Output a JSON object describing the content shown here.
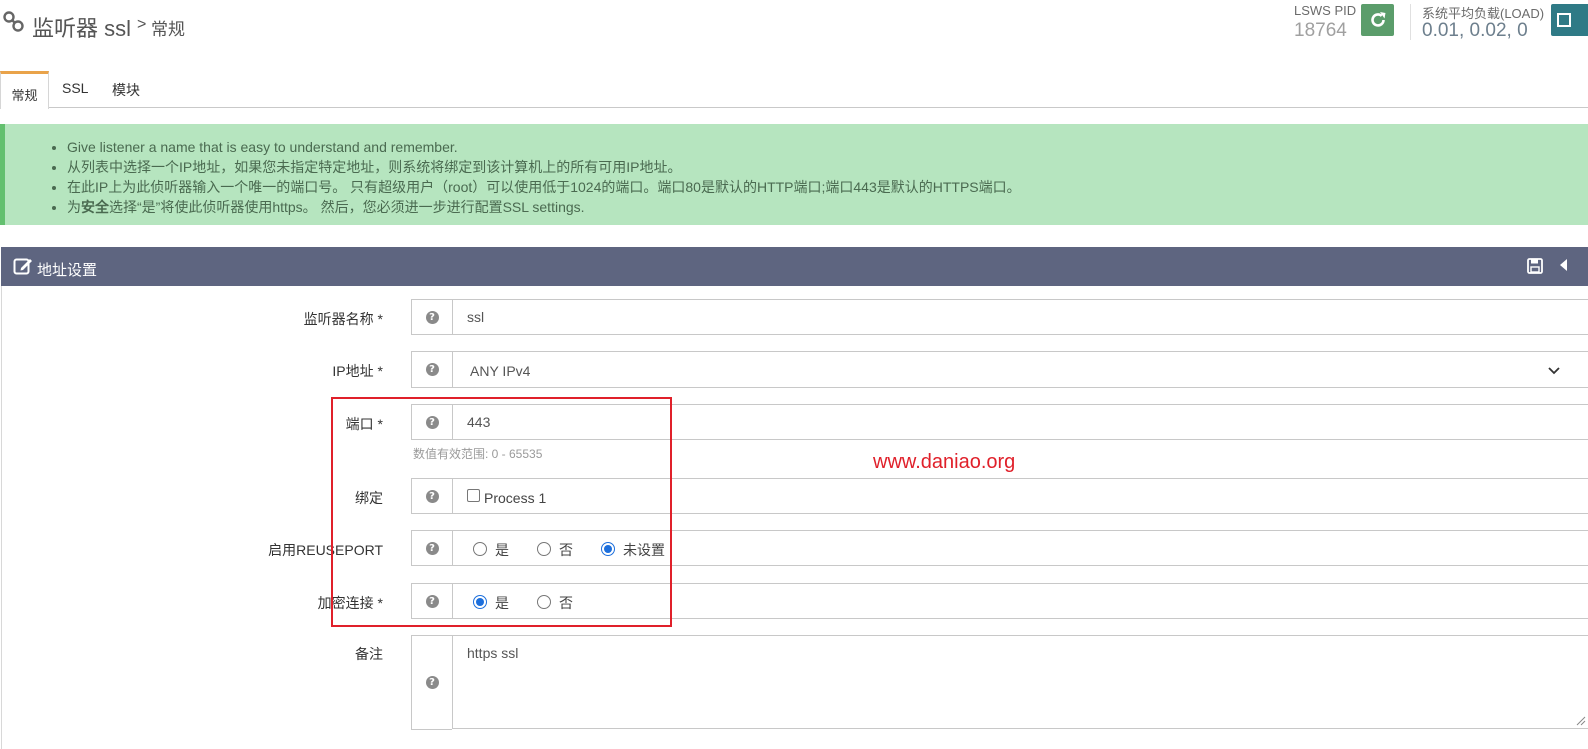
{
  "header": {
    "title": "监听器 ssl",
    "separator": ">",
    "subtitle": "常规",
    "pid_label": "LSWS PID",
    "pid_value": "18764",
    "load_label": "系统平均负载(LOAD)",
    "load_value": "0.01, 0.02, 0"
  },
  "tabs": [
    {
      "label": "常规",
      "active": true
    },
    {
      "label": "SSL",
      "active": false
    },
    {
      "label": "模块",
      "active": false
    }
  ],
  "alert": {
    "items": [
      "Give listener a name that is easy to understand and remember.",
      "从列表中选择一个IP地址，如果您未指定特定地址，则系统将绑定到该计算机上的所有可用IP地址。",
      "在此IP上为此侦听器输入一个唯一的端口号。 只有超级用户（root）可以使用低于1024的端口。端口80是默认的HTTP端口;端口443是默认的HTTPS端口。",
      "为",
      "安全",
      "选择“是”将使此侦听器使用https。 然后，您必须进一步进行配置SSL settings."
    ]
  },
  "panel": {
    "title": "地址设置"
  },
  "form": {
    "name": {
      "label": "监听器名称 *",
      "value": "ssl"
    },
    "ip": {
      "label": "IP地址 *",
      "value": "ANY IPv4"
    },
    "port": {
      "label": "端口 *",
      "value": "443",
      "hint": "数值有效范围: 0 - 65535"
    },
    "binding": {
      "label": "绑定",
      "option": "Process 1",
      "checked": false
    },
    "reuseport": {
      "label": "启用REUSEPORT",
      "options": [
        "是",
        "否",
        "未设置"
      ],
      "selected": "未设置"
    },
    "secure": {
      "label": "加密连接 *",
      "options": [
        "是",
        "否"
      ],
      "selected": "是"
    },
    "notes": {
      "label": "备注",
      "value": "https ssl"
    }
  },
  "watermark": "www.daniao.org",
  "colors": {
    "accent_tab": "#e9a34a",
    "alert_bg": "#b6e5bf",
    "panel_header": "#5e6580",
    "restart_btn": "#5b9d6b",
    "highlight_box": "#e0202a"
  }
}
